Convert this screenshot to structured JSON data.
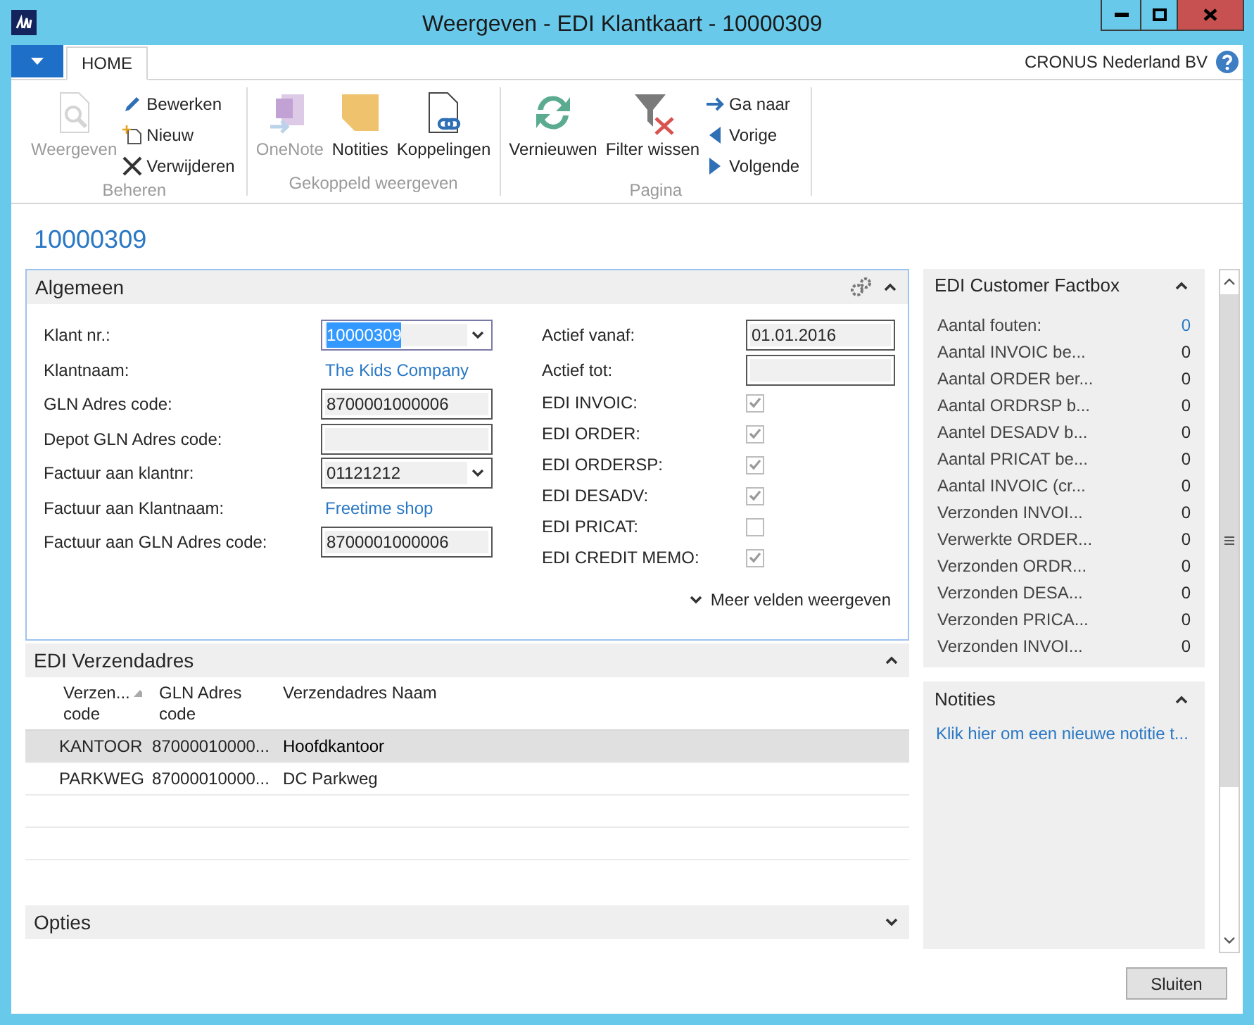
{
  "window": {
    "title": "Weergeven - EDI Klantkaart - 10000309"
  },
  "ribbon": {
    "tabs": [
      {
        "label": "HOME",
        "selected": true
      }
    ],
    "company": "CRONUS Nederland BV",
    "groups": [
      {
        "label": "Beheren",
        "actions": [
          {
            "label": "Weergeven",
            "kind": "large",
            "disabled": true
          },
          {
            "label": "Bewerken",
            "kind": "small",
            "disabled": false
          },
          {
            "label": "Nieuw",
            "kind": "small",
            "disabled": false
          },
          {
            "label": "Verwijderen",
            "kind": "small",
            "disabled": false
          }
        ]
      },
      {
        "label": "Gekoppeld weergeven",
        "actions": [
          {
            "label": "OneNote",
            "kind": "large",
            "disabled": true
          },
          {
            "label": "Notities",
            "kind": "large",
            "disabled": false
          },
          {
            "label": "Koppelingen",
            "kind": "large",
            "disabled": false
          }
        ]
      },
      {
        "label": "Pagina",
        "actions": [
          {
            "label": "Vernieuwen",
            "kind": "large",
            "disabled": false
          },
          {
            "label": "Filter wissen",
            "kind": "large",
            "disabled": false
          },
          {
            "label": "Ga naar",
            "kind": "small",
            "disabled": false
          },
          {
            "label": "Vorige",
            "kind": "small",
            "disabled": false
          },
          {
            "label": "Volgende",
            "kind": "small",
            "disabled": false
          }
        ]
      }
    ]
  },
  "page_title": "10000309",
  "general": {
    "title": "Algemeen",
    "expanded": true,
    "left_fields": [
      {
        "label": "Klant nr.:",
        "kind": "dropdown",
        "value": "10000309",
        "focused": true
      },
      {
        "label": "Klantnaam:",
        "kind": "link",
        "value": "The Kids Company"
      },
      {
        "label": "GLN Adres code:",
        "kind": "text",
        "value": "8700001000006"
      },
      {
        "label": "Depot GLN Adres code:",
        "kind": "text"
      },
      {
        "label": "Factuur aan klantnr:",
        "kind": "dropdown",
        "value": "01121212",
        "focused": false
      },
      {
        "label": "Factuur aan Klantnaam:",
        "kind": "link",
        "value": "Freetime shop"
      },
      {
        "label": "Factuur aan GLN Adres code:",
        "kind": "text",
        "value": "8700001000006"
      }
    ],
    "right_fields": [
      {
        "label": "Actief vanaf:",
        "kind": "text",
        "value": "01.01.2016"
      },
      {
        "label": "Actief tot:",
        "kind": "text"
      },
      {
        "label": "EDI INVOIC:",
        "kind": "checkbox",
        "checked": true
      },
      {
        "label": "EDI ORDER:",
        "kind": "checkbox",
        "checked": true
      },
      {
        "label": "EDI ORDERSP:",
        "kind": "checkbox",
        "checked": true
      },
      {
        "label": "EDI DESADV:",
        "kind": "checkbox",
        "checked": true
      },
      {
        "label": "EDI PRICAT:",
        "kind": "checkbox",
        "checked": false
      },
      {
        "label": "EDI CREDIT MEMO:",
        "kind": "checkbox",
        "checked": true
      }
    ],
    "more_fields": "Meer velden weergeven"
  },
  "ship_to": {
    "title": "EDI Verzendadres",
    "expanded": true,
    "columns": [
      {
        "label": "Verzen... code",
        "sorted": true
      },
      {
        "label": "GLN Adres code",
        "sorted": false
      },
      {
        "label": "Verzendadres Naam",
        "sorted": false
      }
    ],
    "rows": [
      {
        "cells": [
          "KANTOOR",
          "87000010000...",
          "Hoofdkantoor"
        ],
        "selected": true
      },
      {
        "cells": [
          "PARKWEG",
          "87000010000...",
          "DC Parkweg"
        ],
        "selected": false
      }
    ]
  },
  "options": {
    "title": "Opties",
    "expanded": false
  },
  "factbox": {
    "title": "EDI Customer Factbox",
    "expanded": true,
    "rows": [
      {
        "label": "Aantal fouten:",
        "value": "0",
        "link": true
      },
      {
        "label": "Aantal INVOIC be...",
        "value": "0",
        "link": false
      },
      {
        "label": "Aantal ORDER ber...",
        "value": "0",
        "link": false
      },
      {
        "label": "Aantal ORDRSP b...",
        "value": "0",
        "link": false
      },
      {
        "label": "Aantel DESADV b...",
        "value": "0",
        "link": false
      },
      {
        "label": "Aantal PRICAT be...",
        "value": "0",
        "link": false
      },
      {
        "label": "Aantal INVOIC (cr...",
        "value": "0",
        "link": false
      },
      {
        "label": "Verzonden INVOI...",
        "value": "0",
        "link": false
      },
      {
        "label": "Verwerkte ORDER...",
        "value": "0",
        "link": false
      },
      {
        "label": "Verzonden ORDR...",
        "value": "0",
        "link": false
      },
      {
        "label": "Verzonden DESA...",
        "value": "0",
        "link": false
      },
      {
        "label": "Verzonden PRICA...",
        "value": "0",
        "link": false
      },
      {
        "label": "Verzonden INVOI...",
        "value": "0",
        "link": false
      }
    ]
  },
  "notes": {
    "title": "Notities",
    "expanded": true,
    "link": "Klik hier om een nieuwe notitie t..."
  },
  "close_button": "Sluiten"
}
